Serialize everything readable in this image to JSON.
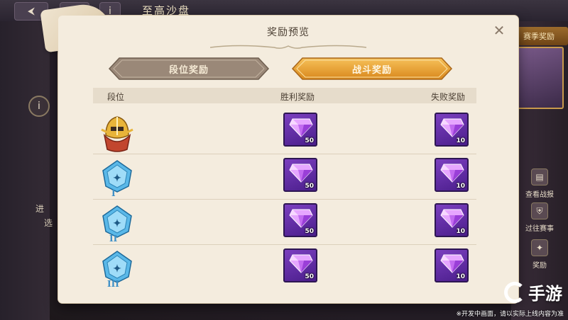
{
  "background": {
    "title": "至高沙盘",
    "right_tab": "赛季奖励",
    "left_text_1": "进",
    "left_text_2": "选",
    "side_items": [
      "查看战报",
      "过往赛事",
      "奖励"
    ]
  },
  "modal": {
    "title": "奖励预览",
    "close_icon": "close-icon",
    "tabs": [
      {
        "label": "段位奖励",
        "active": false
      },
      {
        "label": "战斗奖励",
        "active": true
      }
    ],
    "columns": {
      "rank": "段位",
      "win": "胜利奖励",
      "lose": "失败奖励"
    },
    "rows": [
      {
        "rank_icon": "gold-helmet-rank-icon",
        "rank_numeral": "",
        "win_qty": "50",
        "lose_qty": "10"
      },
      {
        "rank_icon": "diamond-rank-icon",
        "rank_numeral": "I",
        "win_qty": "50",
        "lose_qty": "10"
      },
      {
        "rank_icon": "diamond-rank-icon",
        "rank_numeral": "II",
        "win_qty": "50",
        "lose_qty": "10"
      },
      {
        "rank_icon": "diamond-rank-icon",
        "rank_numeral": "III",
        "win_qty": "50",
        "lose_qty": "10"
      }
    ]
  },
  "watermark": {
    "logo_text": "手游",
    "note": "※开发中画面，请以实际上线内容为准"
  },
  "colors": {
    "tab_active": "#e39a2a",
    "tab_inactive": "#9a8878",
    "reward_bg": "#6a34ad",
    "panel": "#f4ecde"
  }
}
